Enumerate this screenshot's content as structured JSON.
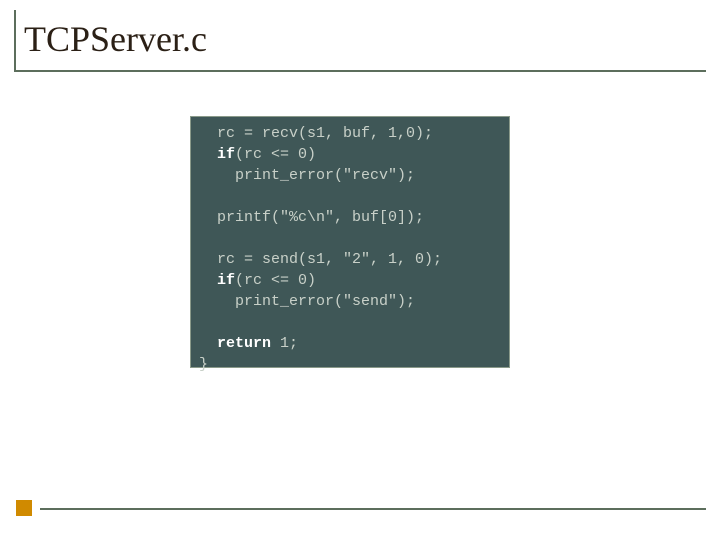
{
  "title": "TCPServer.c",
  "code": {
    "l1a": "  rc = recv(s1, buf, 1,0);",
    "l2kw": "  if",
    "l2b": "(rc <= 0)",
    "l3": "    print_error(\"recv\");",
    "l4": "",
    "l5": "  printf(\"%c\\n\", buf[0]);",
    "l6": "",
    "l7": "  rc = send(s1, \"2\", 1, 0);",
    "l8kw": "  if",
    "l8b": "(rc <= 0)",
    "l9": "    print_error(\"send\");",
    "l10": "",
    "l11kw": "  return",
    "l11b": " 1;",
    "l12": "}"
  }
}
